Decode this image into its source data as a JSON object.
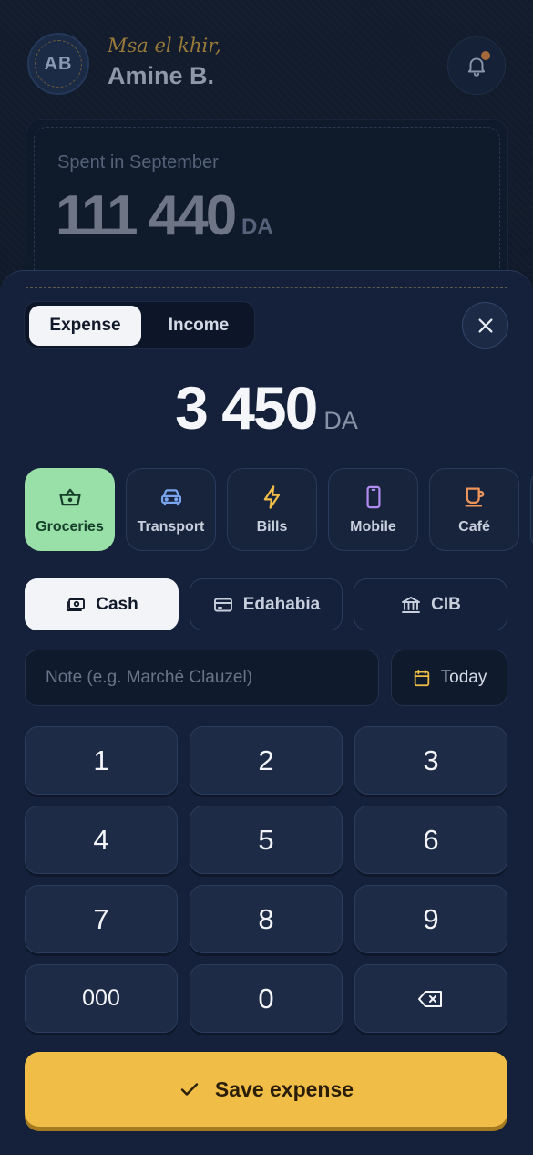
{
  "header": {
    "avatar_initials": "AB",
    "greeting": "Msa el khir,",
    "user_name": "Amine B."
  },
  "summary": {
    "label": "Spent in September",
    "amount": "111 440",
    "currency": "DA"
  },
  "sheet": {
    "type_toggle": {
      "expense": "Expense",
      "income": "Income",
      "selected": "Expense"
    },
    "amount": "3 450",
    "currency": "DA",
    "categories": [
      {
        "label": "Groceries",
        "icon": "basket-icon",
        "color": "#98dfa8",
        "selected": true
      },
      {
        "label": "Transport",
        "icon": "car-icon",
        "color": "#7aa6f0",
        "selected": false
      },
      {
        "label": "Bills",
        "icon": "bolt-icon",
        "color": "#f0bd47",
        "selected": false
      },
      {
        "label": "Mobile",
        "icon": "phone-icon",
        "color": "#b08cf0",
        "selected": false
      },
      {
        "label": "Café",
        "icon": "coffee-icon",
        "color": "#f0955a",
        "selected": false
      }
    ],
    "payment_methods": [
      {
        "label": "Cash",
        "icon": "cash-icon",
        "selected": true
      },
      {
        "label": "Edahabia",
        "icon": "card-icon",
        "selected": false
      },
      {
        "label": "CIB",
        "icon": "bank-icon",
        "selected": false
      }
    ],
    "note_placeholder": "Note (e.g. Marché Clauzel)",
    "date_label": "Today",
    "keypad": [
      "1",
      "2",
      "3",
      "4",
      "5",
      "6",
      "7",
      "8",
      "9",
      "000",
      "0",
      "backspace"
    ],
    "save_label": "Save expense"
  },
  "colors": {
    "accent": "#f0bd47",
    "selected_category": "#98dfa8",
    "sheet_bg": "#15213a"
  }
}
